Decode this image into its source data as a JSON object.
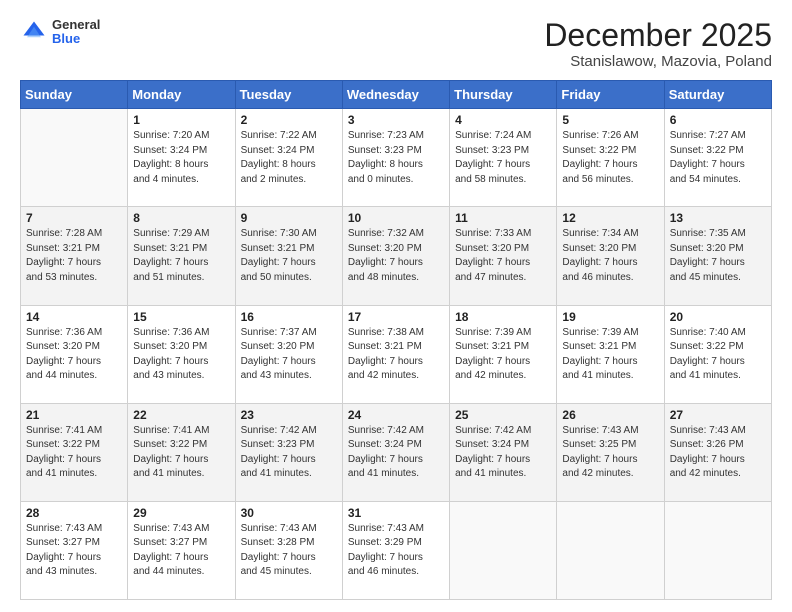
{
  "header": {
    "logo_general": "General",
    "logo_blue": "Blue",
    "month_title": "December 2025",
    "location": "Stanislawow, Mazovia, Poland"
  },
  "weekdays": [
    "Sunday",
    "Monday",
    "Tuesday",
    "Wednesday",
    "Thursday",
    "Friday",
    "Saturday"
  ],
  "weeks": [
    {
      "shaded": false,
      "days": [
        {
          "num": "",
          "info": ""
        },
        {
          "num": "1",
          "info": "Sunrise: 7:20 AM\nSunset: 3:24 PM\nDaylight: 8 hours\nand 4 minutes."
        },
        {
          "num": "2",
          "info": "Sunrise: 7:22 AM\nSunset: 3:24 PM\nDaylight: 8 hours\nand 2 minutes."
        },
        {
          "num": "3",
          "info": "Sunrise: 7:23 AM\nSunset: 3:23 PM\nDaylight: 8 hours\nand 0 minutes."
        },
        {
          "num": "4",
          "info": "Sunrise: 7:24 AM\nSunset: 3:23 PM\nDaylight: 7 hours\nand 58 minutes."
        },
        {
          "num": "5",
          "info": "Sunrise: 7:26 AM\nSunset: 3:22 PM\nDaylight: 7 hours\nand 56 minutes."
        },
        {
          "num": "6",
          "info": "Sunrise: 7:27 AM\nSunset: 3:22 PM\nDaylight: 7 hours\nand 54 minutes."
        }
      ]
    },
    {
      "shaded": true,
      "days": [
        {
          "num": "7",
          "info": "Sunrise: 7:28 AM\nSunset: 3:21 PM\nDaylight: 7 hours\nand 53 minutes."
        },
        {
          "num": "8",
          "info": "Sunrise: 7:29 AM\nSunset: 3:21 PM\nDaylight: 7 hours\nand 51 minutes."
        },
        {
          "num": "9",
          "info": "Sunrise: 7:30 AM\nSunset: 3:21 PM\nDaylight: 7 hours\nand 50 minutes."
        },
        {
          "num": "10",
          "info": "Sunrise: 7:32 AM\nSunset: 3:20 PM\nDaylight: 7 hours\nand 48 minutes."
        },
        {
          "num": "11",
          "info": "Sunrise: 7:33 AM\nSunset: 3:20 PM\nDaylight: 7 hours\nand 47 minutes."
        },
        {
          "num": "12",
          "info": "Sunrise: 7:34 AM\nSunset: 3:20 PM\nDaylight: 7 hours\nand 46 minutes."
        },
        {
          "num": "13",
          "info": "Sunrise: 7:35 AM\nSunset: 3:20 PM\nDaylight: 7 hours\nand 45 minutes."
        }
      ]
    },
    {
      "shaded": false,
      "days": [
        {
          "num": "14",
          "info": "Sunrise: 7:36 AM\nSunset: 3:20 PM\nDaylight: 7 hours\nand 44 minutes."
        },
        {
          "num": "15",
          "info": "Sunrise: 7:36 AM\nSunset: 3:20 PM\nDaylight: 7 hours\nand 43 minutes."
        },
        {
          "num": "16",
          "info": "Sunrise: 7:37 AM\nSunset: 3:20 PM\nDaylight: 7 hours\nand 43 minutes."
        },
        {
          "num": "17",
          "info": "Sunrise: 7:38 AM\nSunset: 3:21 PM\nDaylight: 7 hours\nand 42 minutes."
        },
        {
          "num": "18",
          "info": "Sunrise: 7:39 AM\nSunset: 3:21 PM\nDaylight: 7 hours\nand 42 minutes."
        },
        {
          "num": "19",
          "info": "Sunrise: 7:39 AM\nSunset: 3:21 PM\nDaylight: 7 hours\nand 41 minutes."
        },
        {
          "num": "20",
          "info": "Sunrise: 7:40 AM\nSunset: 3:22 PM\nDaylight: 7 hours\nand 41 minutes."
        }
      ]
    },
    {
      "shaded": true,
      "days": [
        {
          "num": "21",
          "info": "Sunrise: 7:41 AM\nSunset: 3:22 PM\nDaylight: 7 hours\nand 41 minutes."
        },
        {
          "num": "22",
          "info": "Sunrise: 7:41 AM\nSunset: 3:22 PM\nDaylight: 7 hours\nand 41 minutes."
        },
        {
          "num": "23",
          "info": "Sunrise: 7:42 AM\nSunset: 3:23 PM\nDaylight: 7 hours\nand 41 minutes."
        },
        {
          "num": "24",
          "info": "Sunrise: 7:42 AM\nSunset: 3:24 PM\nDaylight: 7 hours\nand 41 minutes."
        },
        {
          "num": "25",
          "info": "Sunrise: 7:42 AM\nSunset: 3:24 PM\nDaylight: 7 hours\nand 41 minutes."
        },
        {
          "num": "26",
          "info": "Sunrise: 7:43 AM\nSunset: 3:25 PM\nDaylight: 7 hours\nand 42 minutes."
        },
        {
          "num": "27",
          "info": "Sunrise: 7:43 AM\nSunset: 3:26 PM\nDaylight: 7 hours\nand 42 minutes."
        }
      ]
    },
    {
      "shaded": false,
      "days": [
        {
          "num": "28",
          "info": "Sunrise: 7:43 AM\nSunset: 3:27 PM\nDaylight: 7 hours\nand 43 minutes."
        },
        {
          "num": "29",
          "info": "Sunrise: 7:43 AM\nSunset: 3:27 PM\nDaylight: 7 hours\nand 44 minutes."
        },
        {
          "num": "30",
          "info": "Sunrise: 7:43 AM\nSunset: 3:28 PM\nDaylight: 7 hours\nand 45 minutes."
        },
        {
          "num": "31",
          "info": "Sunrise: 7:43 AM\nSunset: 3:29 PM\nDaylight: 7 hours\nand 46 minutes."
        },
        {
          "num": "",
          "info": ""
        },
        {
          "num": "",
          "info": ""
        },
        {
          "num": "",
          "info": ""
        }
      ]
    }
  ]
}
